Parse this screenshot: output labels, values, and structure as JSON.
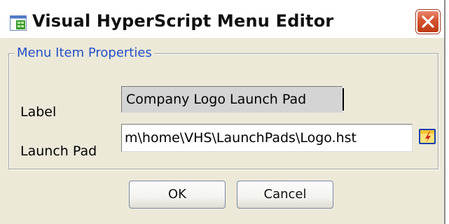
{
  "window": {
    "title": "Visual HyperScript Menu Editor",
    "title_icon": "app-icon",
    "close_icon": "close-icon"
  },
  "group": {
    "legend": "Menu Item Properties"
  },
  "fields": {
    "label": {
      "caption": "Label",
      "value": "Company Logo Launch Pad"
    },
    "launch_pad": {
      "caption": "Launch Pad",
      "value": "m\\home\\VHS\\LaunchPads\\Logo.hst",
      "browse_icon": "folder-browse-icon"
    }
  },
  "buttons": {
    "ok": "OK",
    "cancel": "Cancel"
  },
  "colors": {
    "legend_text": "#2550c8",
    "dialog_background": "#ece9d8",
    "close_button": "#d4532e"
  }
}
